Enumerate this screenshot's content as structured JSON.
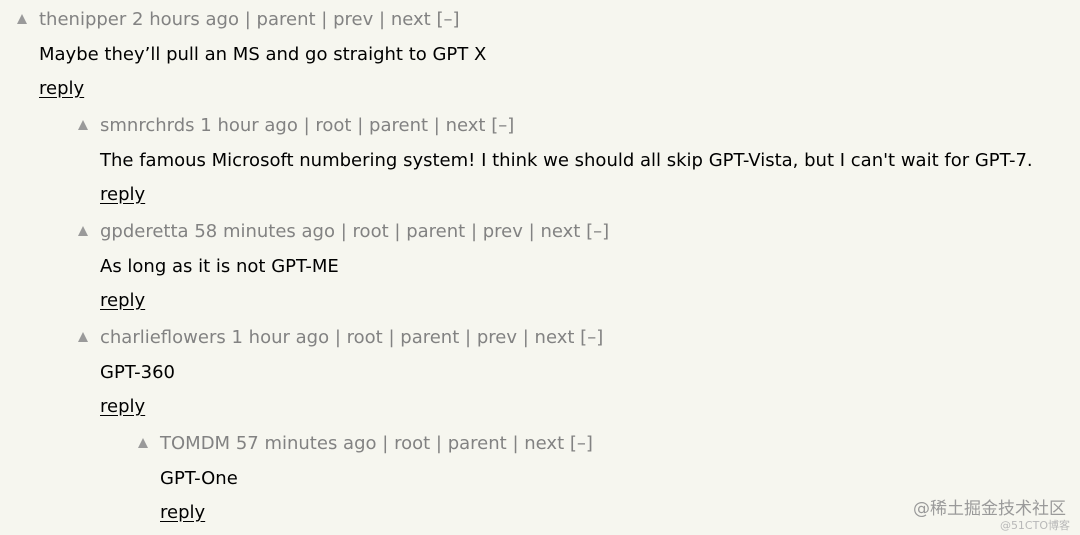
{
  "comments": [
    {
      "user": "thenipper",
      "age": "2 hours ago",
      "links": [
        "parent",
        "prev",
        "next"
      ],
      "toggle": "[–]",
      "text": "Maybe they’ll pull an MS and go straight to GPT X",
      "reply": "reply"
    },
    {
      "user": "smnrchrds",
      "age": "1 hour ago",
      "links": [
        "root",
        "parent",
        "next"
      ],
      "toggle": "[–]",
      "text": "The famous Microsoft numbering system! I think we should all skip GPT-Vista, but I can't wait for GPT-7.",
      "reply": "reply"
    },
    {
      "user": "gpderetta",
      "age": "58 minutes ago",
      "links": [
        "root",
        "parent",
        "prev",
        "next"
      ],
      "toggle": "[–]",
      "text": "As long as it is not GPT-ME",
      "reply": "reply"
    },
    {
      "user": "charlieflowers",
      "age": "1 hour ago",
      "links": [
        "root",
        "parent",
        "prev",
        "next"
      ],
      "toggle": "[–]",
      "text": "GPT-360",
      "reply": "reply"
    },
    {
      "user": "TOMDM",
      "age": "57 minutes ago",
      "links": [
        "root",
        "parent",
        "next"
      ],
      "toggle": "[–]",
      "text": "GPT-One",
      "reply": "reply"
    }
  ],
  "separator": "|",
  "watermark": {
    "main": "@稀土掘金技术社区",
    "sub": "@51CTO博客"
  },
  "colors": {
    "background": "#f6f6ef",
    "meta_text": "#828282",
    "body_text": "#000000",
    "vote_arrow": "#9a9a9a"
  },
  "icons": {
    "vote": "upvote-arrow-icon"
  }
}
